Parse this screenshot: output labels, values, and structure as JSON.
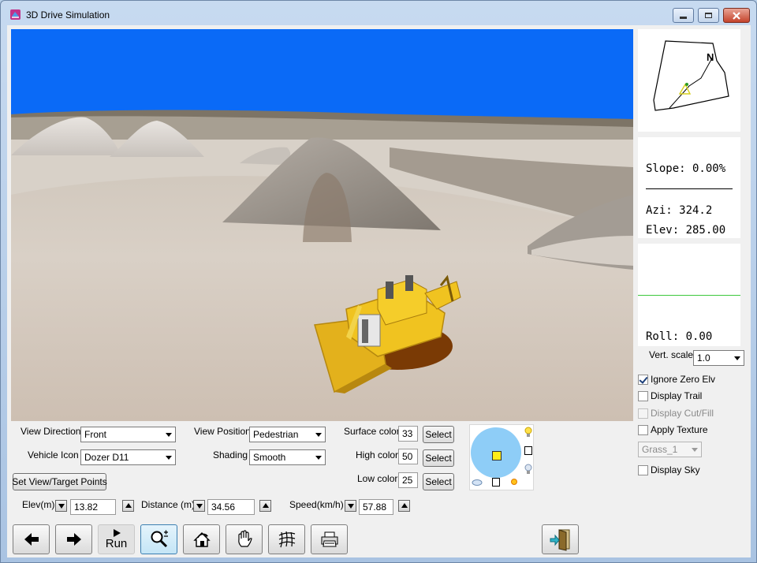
{
  "window": {
    "title": "3D Drive Simulation"
  },
  "minimap": {
    "north_label": "N"
  },
  "info": {
    "slope": "Slope: 0.00%",
    "azi": "Azi: 324.2",
    "elev": "Elev: 285.00",
    "roll": "Roll: 0.00"
  },
  "vert_scale": {
    "label": "Vert. scale",
    "value": "1.0"
  },
  "options": [
    {
      "label": "Ignore Zero Elv",
      "checked": true,
      "enabled": true
    },
    {
      "label": "Display Trail",
      "checked": false,
      "enabled": true
    },
    {
      "label": "Display Cut/Fill",
      "checked": false,
      "enabled": false
    },
    {
      "label": "Apply Texture",
      "checked": false,
      "enabled": true
    }
  ],
  "texture": {
    "value": "Grass_1"
  },
  "display_sky": {
    "label": "Display Sky",
    "checked": false
  },
  "controls": {
    "view_direction": {
      "label": "View Direction",
      "value": "Front"
    },
    "vehicle_icon": {
      "label": "Vehicle Icon",
      "value": "Dozer D11"
    },
    "view_position": {
      "label": "View Position",
      "value": "Pedestrian"
    },
    "shading": {
      "label": "Shading",
      "value": "Smooth"
    },
    "set_points_button": "Set View/Target Points",
    "surface_color": {
      "label": "Surface color",
      "value": "33"
    },
    "high_color": {
      "label": "High color",
      "value": "50"
    },
    "low_color": {
      "label": "Low color",
      "value": "25"
    },
    "select_label": "Select",
    "elev": {
      "label": "Elev(m)",
      "value": "13.82"
    },
    "distance": {
      "label": "Distance (m)",
      "value": "34.56"
    },
    "speed": {
      "label": "Speed(km/h)",
      "value": "57.88"
    }
  },
  "toolbar": {
    "run_label": "Run",
    "buttons": [
      "arrow-left-icon",
      "arrow-right-icon",
      "run-play-icon",
      "zoom-icon",
      "rotate-view-icon",
      "pan-hand-icon",
      "wireframe-icon",
      "print-icon",
      "exit-door-icon"
    ]
  },
  "colors": {
    "sky": "#0a6af7",
    "light_disc": "#8ecdf7",
    "dozer_yellow": "#e8b81a",
    "roll_line": "#3cc83c"
  }
}
